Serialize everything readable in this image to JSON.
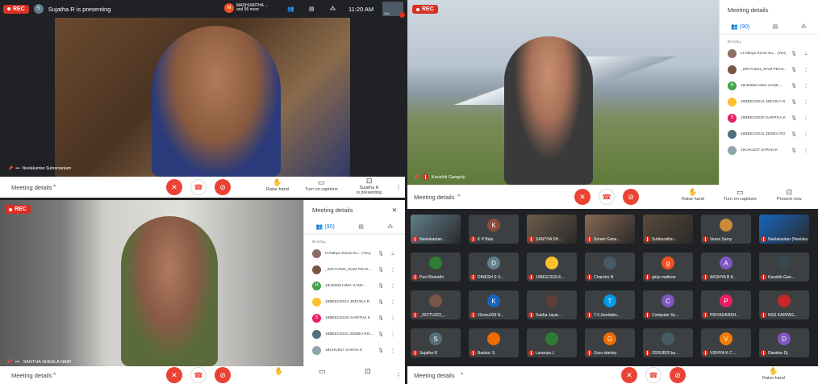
{
  "q1": {
    "rec": "REC",
    "presenter_initial": "S",
    "presenter_text": "Sujatha R is presenting",
    "participants_initial": "M",
    "participants_line1": "MADHUMITHA ...",
    "participants_line2": "and 95 more",
    "time": "11:20 AM",
    "you_label": "You",
    "tile_name": "Neelakantan Subramaniam",
    "meeting_details": "Meeting details",
    "raise_hand": "Raise hand",
    "captions": "Turn on captions",
    "presenting_line1": "Sujatha R",
    "presenting_line2": "is presenting"
  },
  "q2": {
    "rec": "REC",
    "tile_name": "Kaushik Ganguly",
    "meeting_details": "Meeting details",
    "raise_hand": "Raise hand",
    "captions": "Turn on captions",
    "present_now": "Present now",
    "panel_title": "Meeting details",
    "people_count": "(90)",
    "in_call": "IN CALL"
  },
  "q3": {
    "rec": "REC",
    "tile_name": "SANTHA SHEELA NAIR",
    "meeting_details": "Meeting details",
    "panel_title": "Meeting details",
    "people_count": "(90)",
    "in_call": "IN CALL"
  },
  "q4": {
    "meeting_details": "Meeting details",
    "raise_hand": "Raise hand"
  },
  "people": [
    {
      "initial": "",
      "name": "Lt.Nithya Soma Su... (You)",
      "color": "#8d6e63",
      "pin": true
    },
    {
      "initial": "",
      "name": "_20CTU022_RAM PRAS...",
      "color": "#795548",
      "pin": false
    },
    {
      "initial": "H",
      "name": "18cbt008 HIMA SANK...",
      "color": "#43a047",
      "pin": false
    },
    {
      "initial": "",
      "name": "19BEECE014 JEEVIKA R",
      "color": "#fbc02d",
      "pin": false
    },
    {
      "initial": "S",
      "name": "19BEECE030 SARITHA K",
      "color": "#e91e63",
      "pin": false
    },
    {
      "initial": "",
      "name": "19BEECE041 ZEEBU RO...",
      "color": "#546e7a",
      "pin": false
    },
    {
      "initial": "",
      "name": "19CHU037 SARAN K",
      "color": "#90a4ae",
      "pin": false
    }
  ],
  "grid": [
    {
      "name": "Neelakantan...",
      "initial": "",
      "color": "#607d8b",
      "photo": true
    },
    {
      "name": "K P Balu",
      "initial": "K",
      "color": "#8d4a3a",
      "photo": false
    },
    {
      "name": "SANTHA SH...",
      "initial": "",
      "color": "#6d5d4b",
      "photo": true
    },
    {
      "name": "Sriram Gana...",
      "initial": "",
      "color": "#8a6a55",
      "photo": true
    },
    {
      "name": "Subburathin...",
      "initial": "",
      "color": "#5a4a3a",
      "photo": true
    },
    {
      "name": "Veera Samy",
      "initial": "",
      "color": "#c98a3a",
      "photo": false
    },
    {
      "name": "Neelakantan (Neelakantan...",
      "initial": "",
      "color": "#1565c0",
      "photo": true
    },
    {
      "name": "Pavi Bharathi",
      "initial": "",
      "color": "#2e7d32",
      "photo": false
    },
    {
      "name": "DINESH S V...",
      "initial": "D",
      "color": "#607d8b",
      "photo": false
    },
    {
      "name": "19BEECE014...",
      "initial": "",
      "color": "#fbc02d",
      "photo": false
    },
    {
      "name": "Chandru N",
      "initial": "",
      "color": "#455a64",
      "photo": false
    },
    {
      "name": "ginju mathew",
      "initial": "g",
      "color": "#f4511e",
      "photo": false
    },
    {
      "name": "AKSHYA B K...",
      "initial": "A",
      "color": "#7e57c2",
      "photo": false
    },
    {
      "name": "Kaushik Gan...",
      "initial": "",
      "color": "#37474f",
      "photo": false
    },
    {
      "name": "_20CTU022_...",
      "initial": "",
      "color": "#795548",
      "photo": false
    },
    {
      "name": "20cmu039 N...",
      "initial": "K",
      "color": "#1565c0",
      "photo": false
    },
    {
      "name": "Subha Jayar...",
      "initial": "",
      "color": "#5d4037",
      "photo": false
    },
    {
      "name": "T.V.Jemilakis...",
      "initial": "T",
      "color": "#039be5",
      "photo": false
    },
    {
      "name": "Computer Sc...",
      "initial": "C",
      "color": "#7e57c2",
      "photo": false
    },
    {
      "name": "PRIYADARSH...",
      "initial": "P",
      "color": "#e91e63",
      "photo": false
    },
    {
      "name": "NSS KARPAG...",
      "initial": "",
      "color": "#c62828",
      "photo": false
    },
    {
      "name": "Sujatha R",
      "initial": "S",
      "color": "#546e7a",
      "photo": false
    },
    {
      "name": "Baskar. S",
      "initial": "",
      "color": "#ef6c00",
      "photo": false
    },
    {
      "name": "Lavanya J",
      "initial": "",
      "color": "#2e7d32",
      "photo": false
    },
    {
      "name": "Guru stanley",
      "initial": "G",
      "color": "#ef6c00",
      "photo": false
    },
    {
      "name": "2026JB20 ka...",
      "initial": "",
      "color": "#455a64",
      "photo": false
    },
    {
      "name": "VIDHYA K C ...",
      "initial": "V",
      "color": "#f57c00",
      "photo": false
    },
    {
      "name": "Diwahar Dj",
      "initial": "D",
      "color": "#7e57c2",
      "photo": false
    }
  ]
}
